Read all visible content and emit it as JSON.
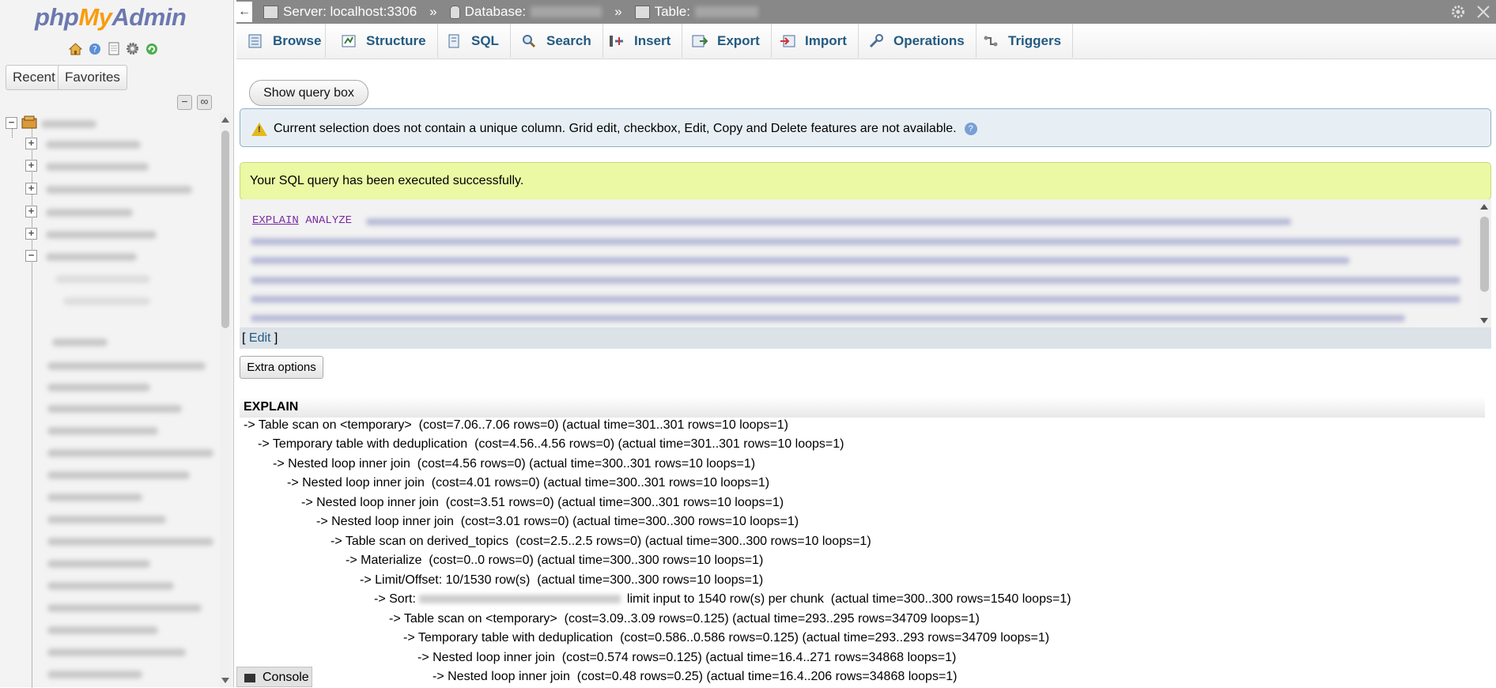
{
  "logo": {
    "php": "php",
    "my": "My",
    "admin": "Admin"
  },
  "nav": {
    "icons": [
      "home-icon",
      "help-icon",
      "documentation-icon",
      "settings-icon",
      "reload-icon"
    ],
    "recent_label": "Recent",
    "favorites_label": "Favorites",
    "collapse_symbol": "−",
    "link_symbol": "∞",
    "expander_plus": "+",
    "expander_minus": "−"
  },
  "topbar": {
    "back": "←",
    "server_label": "Server: localhost:3306",
    "database_label": "Database:",
    "table_label": "Table:",
    "separator": "»"
  },
  "tabs": [
    {
      "label": "Browse",
      "icon": "browse-icon"
    },
    {
      "label": "Structure",
      "icon": "structure-icon"
    },
    {
      "label": "SQL",
      "icon": "sql-icon"
    },
    {
      "label": "Search",
      "icon": "search-icon"
    },
    {
      "label": "Insert",
      "icon": "insert-icon"
    },
    {
      "label": "Export",
      "icon": "export-icon"
    },
    {
      "label": "Import",
      "icon": "import-icon"
    },
    {
      "label": "Operations",
      "icon": "operations-icon"
    },
    {
      "label": "Triggers",
      "icon": "triggers-icon"
    }
  ],
  "content": {
    "show_query_box": "Show query box",
    "notice": "Current selection does not contain a unique column. Grid edit, checkbox, Edit, Copy and Delete features are not available.",
    "notice_help": "?",
    "success": "Your SQL query has been executed successfully.",
    "sql_keyword_1": "EXPLAIN",
    "sql_keyword_2": "ANALYZE",
    "edit_open": "[ ",
    "edit_link": "Edit",
    "edit_close": " ]",
    "extra_options": "Extra options",
    "explain_header": "EXPLAIN",
    "explain_rows": [
      "-> Table scan on <temporary>  (cost=7.06..7.06 rows=0) (actual time=301..301 rows=10 loops=1)",
      "-> Temporary table with deduplication  (cost=4.56..4.56 rows=0) (actual time=301..301 rows=10 loops=1)",
      "-> Nested loop inner join  (cost=4.56 rows=0) (actual time=300..301 rows=10 loops=1)",
      "-> Nested loop inner join  (cost=4.01 rows=0) (actual time=300..301 rows=10 loops=1)",
      "-> Nested loop inner join  (cost=3.51 rows=0) (actual time=300..301 rows=10 loops=1)",
      "-> Nested loop inner join  (cost=3.01 rows=0) (actual time=300..300 rows=10 loops=1)",
      "-> Table scan on derived_topics  (cost=2.5..2.5 rows=0) (actual time=300..300 rows=10 loops=1)",
      "-> Materialize  (cost=0..0 rows=0) (actual time=300..300 rows=10 loops=1)",
      "-> Limit/Offset: 10/1530 row(s)  (actual time=300..300 rows=10 loops=1)",
      "-> Table scan on <temporary>  (cost=3.09..3.09 rows=0.125) (actual time=293..295 rows=34709 loops=1)",
      "-> Temporary table with deduplication  (cost=0.586..0.586 rows=0.125) (actual time=293..293 rows=34709 loops=1)",
      "-> Nested loop inner join  (cost=0.574 rows=0.125) (actual time=16.4..271 rows=34868 loops=1)",
      "-> Nested loop inner join  (cost=0.48 rows=0.25) (actual time=16.4..206 rows=34868 loops=1)"
    ],
    "sort_prefix": "-> Sort:",
    "sort_suffix": "limit input to 1540 row(s) per chunk  (actual time=300..300 rows=1540 loops=1)"
  },
  "console_label": "Console"
}
